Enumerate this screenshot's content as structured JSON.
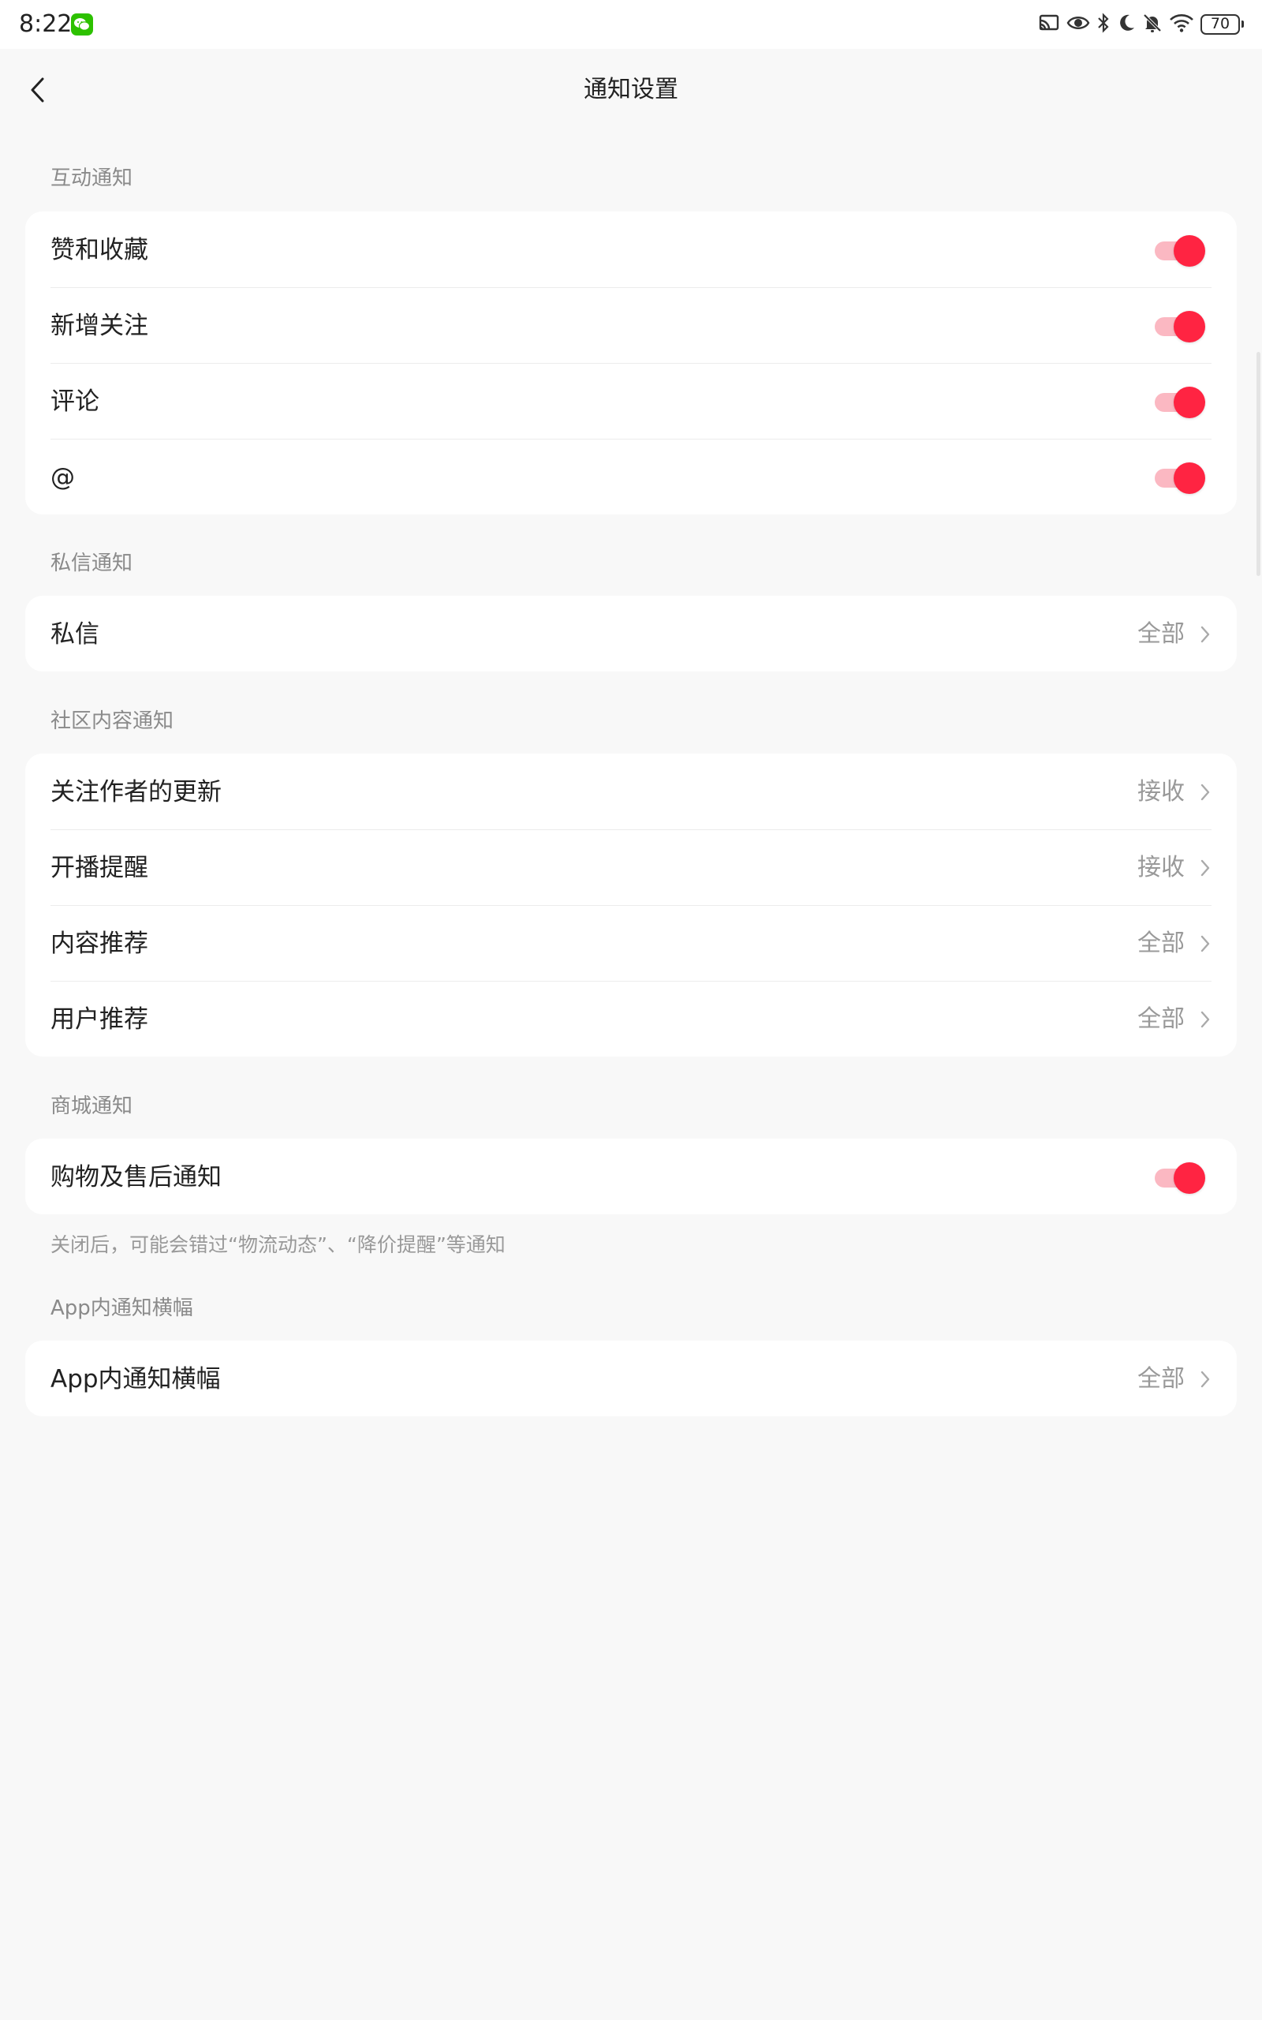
{
  "status_bar": {
    "time": "8:22",
    "battery": "70",
    "icons": [
      "wechat-icon",
      "cast-icon",
      "eye-icon",
      "bluetooth-icon",
      "moon-icon",
      "bell-off-icon",
      "wifi-icon",
      "battery-icon"
    ]
  },
  "header": {
    "title": "通知设置",
    "back_icon": "back-arrow-icon"
  },
  "sections": {
    "interactive": {
      "label": "互动通知",
      "items": [
        {
          "label": "赞和收藏",
          "enabled": true
        },
        {
          "label": "新增关注",
          "enabled": true
        },
        {
          "label": "评论",
          "enabled": true
        },
        {
          "label": "@",
          "enabled": true
        }
      ]
    },
    "private_message": {
      "label": "私信通知",
      "items": [
        {
          "label": "私信",
          "value": "全部"
        }
      ]
    },
    "community": {
      "label": "社区内容通知",
      "items": [
        {
          "label": "关注作者的更新",
          "value": "接收"
        },
        {
          "label": "开播提醒",
          "value": "接收"
        },
        {
          "label": "内容推荐",
          "value": "全部"
        },
        {
          "label": "用户推荐",
          "value": "全部"
        }
      ]
    },
    "mall": {
      "label": "商城通知",
      "items": [
        {
          "label": "购物及售后通知",
          "enabled": true
        }
      ],
      "footnote": "关闭后，可能会错过“物流动态”、“降价提醒”等通知"
    },
    "in_app_banner": {
      "label": "App内通知横幅",
      "items": [
        {
          "label": "App内通知横幅",
          "value": "全部"
        }
      ]
    }
  },
  "colors": {
    "accent": "#ff2442",
    "toggle_track": "#fbb8c2",
    "background": "#f8f8f8",
    "card": "#ffffff",
    "secondary_text": "#999999"
  }
}
